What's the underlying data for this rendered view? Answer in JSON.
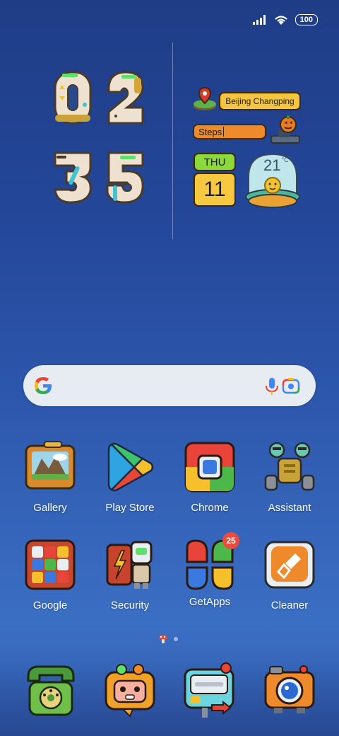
{
  "status_bar": {
    "battery": "100"
  },
  "clock": {
    "hours": "02",
    "minutes": "35"
  },
  "widgets": {
    "location": "Beijing Changping",
    "steps_label": "Steps",
    "weekday": "THU",
    "day": "11",
    "temperature": "21",
    "temp_unit": "°C"
  },
  "apps": [
    {
      "label": "Gallery",
      "icon": "gallery-icon"
    },
    {
      "label": "Play Store",
      "icon": "play-store-icon"
    },
    {
      "label": "Chrome",
      "icon": "chrome-icon"
    },
    {
      "label": "Assistant",
      "icon": "assistant-icon"
    },
    {
      "label": "Google",
      "icon": "google-folder-icon"
    },
    {
      "label": "Security",
      "icon": "security-icon"
    },
    {
      "label": "GetApps",
      "icon": "getapps-icon",
      "badge": "25"
    },
    {
      "label": "Cleaner",
      "icon": "cleaner-icon"
    }
  ],
  "dock": [
    "phone-icon",
    "messages-icon",
    "settings-icon",
    "camera-icon"
  ],
  "colors": {
    "accent_yellow": "#f5c540",
    "accent_orange": "#ee8a2b",
    "accent_green": "#8bd93a"
  }
}
